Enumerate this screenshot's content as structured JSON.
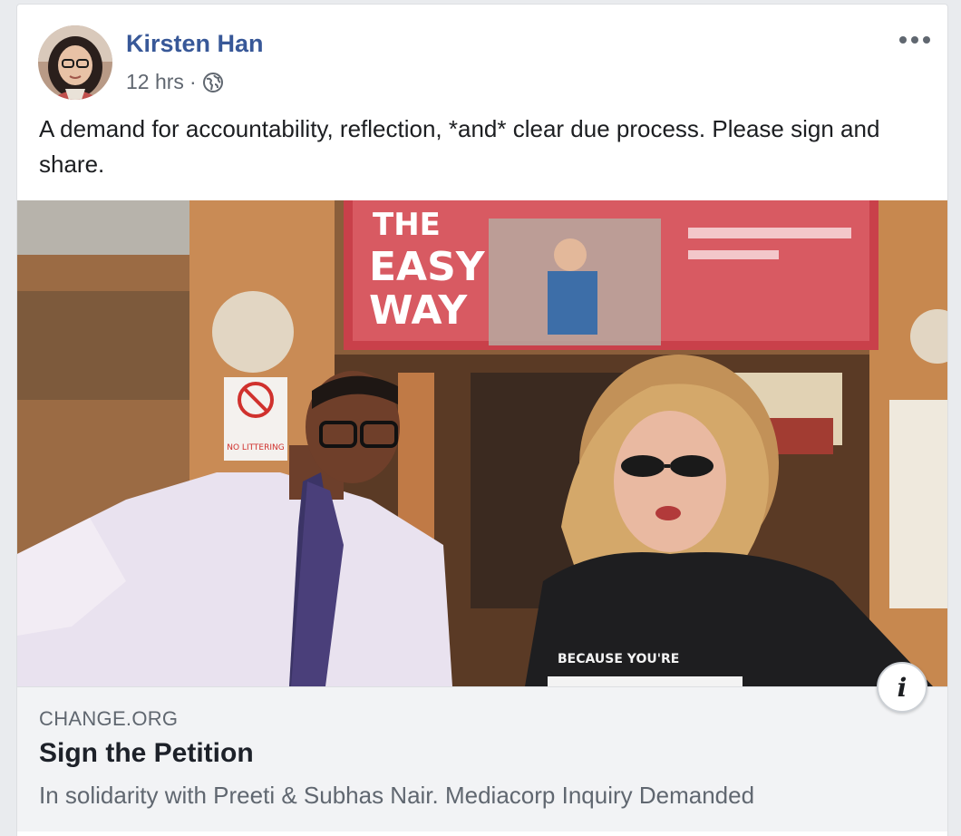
{
  "post": {
    "author": "Kirsten Han",
    "timestamp": "12 hrs",
    "separator": "·",
    "privacy_icon": "globe-icon",
    "text": "A demand for accountability, reflection, *and* clear due process. Please sign and share.",
    "more_icon": "more-options-icon"
  },
  "media": {
    "poster_text": [
      "THE",
      "EASY",
      "WAY"
    ],
    "sign_text": "NO LITTERING",
    "shirt_text": "BECAUSE YOU'RE"
  },
  "link_preview": {
    "domain": "CHANGE.ORG",
    "title": "Sign the Petition",
    "description": "In solidarity with Preeti & Subhas Nair. Mediacorp Inquiry Demanded",
    "info_icon_label": "i"
  },
  "colors": {
    "author_link": "#385898",
    "meta_text": "#606770",
    "body_text": "#1c1e21",
    "link_box_bg": "#f2f3f5"
  }
}
